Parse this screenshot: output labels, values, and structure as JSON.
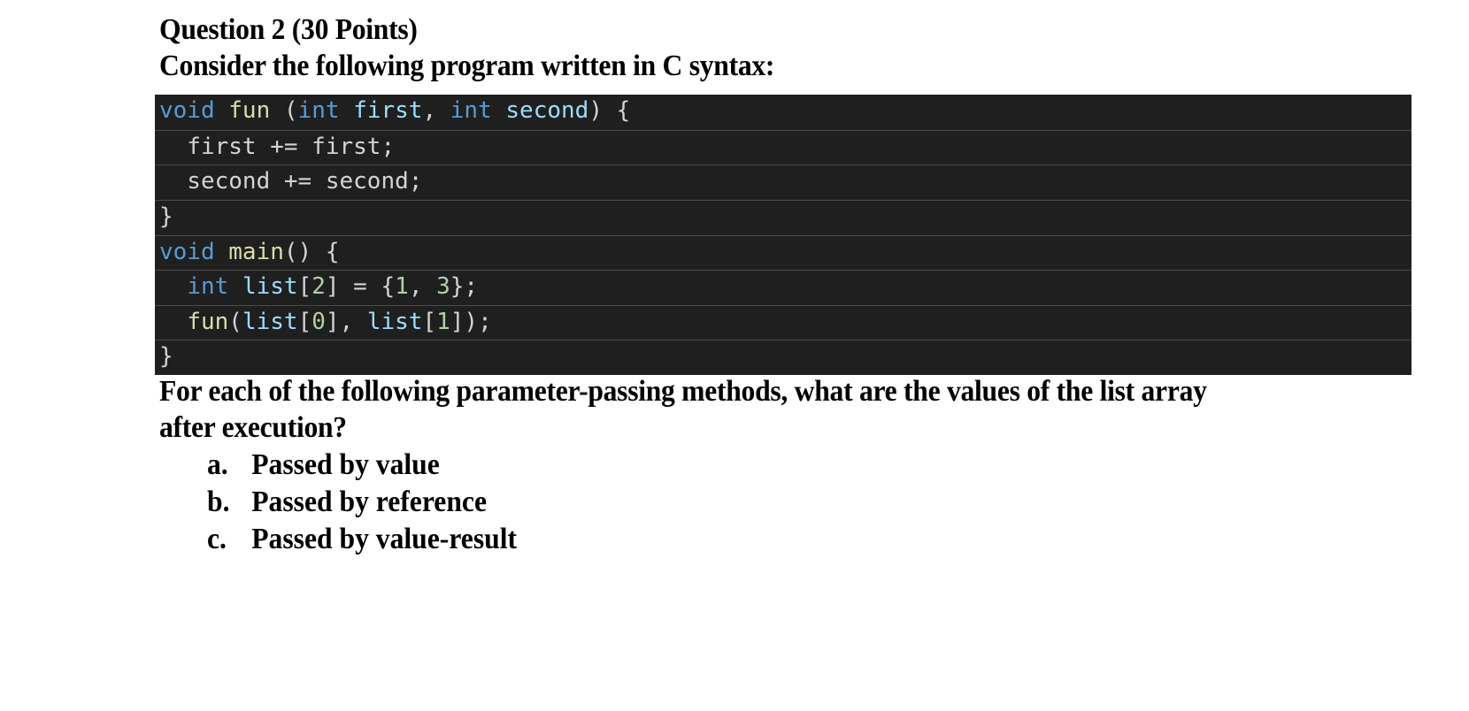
{
  "question": {
    "title": "Question 2 (30 Points)",
    "intro": "Consider the following program written in C syntax:",
    "prompt_line1": "For each of the following parameter-passing methods, what are the values of the list array",
    "prompt_line2": "after execution?",
    "options": [
      {
        "marker": "a.",
        "label": "Passed by value"
      },
      {
        "marker": "b.",
        "label": "Passed by reference"
      },
      {
        "marker": "c.",
        "label": "Passed by value-result"
      }
    ]
  },
  "code": {
    "language": "C",
    "lines": [
      [
        {
          "t": "void",
          "c": "kw"
        },
        {
          "t": " ",
          "c": "plain"
        },
        {
          "t": "fun",
          "c": "fn"
        },
        {
          "t": " (",
          "c": "plain"
        },
        {
          "t": "int",
          "c": "kw"
        },
        {
          "t": " ",
          "c": "plain"
        },
        {
          "t": "first",
          "c": "var"
        },
        {
          "t": ", ",
          "c": "plain"
        },
        {
          "t": "int",
          "c": "kw"
        },
        {
          "t": " ",
          "c": "plain"
        },
        {
          "t": "second",
          "c": "var"
        },
        {
          "t": ") {",
          "c": "plain"
        }
      ],
      [
        {
          "t": "  first += first;",
          "c": "plain"
        }
      ],
      [
        {
          "t": "  second += second;",
          "c": "plain"
        }
      ],
      [
        {
          "t": "}",
          "c": "plain"
        }
      ],
      [
        {
          "t": "void",
          "c": "kw"
        },
        {
          "t": " ",
          "c": "plain"
        },
        {
          "t": "main",
          "c": "fn"
        },
        {
          "t": "() {",
          "c": "plain"
        }
      ],
      [
        {
          "t": "  ",
          "c": "plain"
        },
        {
          "t": "int",
          "c": "kw"
        },
        {
          "t": " ",
          "c": "plain"
        },
        {
          "t": "list",
          "c": "var"
        },
        {
          "t": "[",
          "c": "plain"
        },
        {
          "t": "2",
          "c": "num"
        },
        {
          "t": "] = {",
          "c": "plain"
        },
        {
          "t": "1",
          "c": "num"
        },
        {
          "t": ", ",
          "c": "plain"
        },
        {
          "t": "3",
          "c": "num"
        },
        {
          "t": "};",
          "c": "plain"
        }
      ],
      [
        {
          "t": "  ",
          "c": "plain"
        },
        {
          "t": "fun",
          "c": "fn"
        },
        {
          "t": "(",
          "c": "plain"
        },
        {
          "t": "list",
          "c": "var"
        },
        {
          "t": "[",
          "c": "plain"
        },
        {
          "t": "0",
          "c": "num"
        },
        {
          "t": "], ",
          "c": "plain"
        },
        {
          "t": "list",
          "c": "var"
        },
        {
          "t": "[",
          "c": "plain"
        },
        {
          "t": "1",
          "c": "num"
        },
        {
          "t": "]);",
          "c": "plain"
        }
      ],
      [
        {
          "t": "}",
          "c": "plain"
        }
      ]
    ]
  },
  "colors": {
    "code_background": "#1f1f1f",
    "keyword": "#569cd6",
    "function": "#dcdcaa",
    "variable": "#9cdcfe",
    "number": "#b5cea8",
    "text": "#d4d4d4"
  }
}
